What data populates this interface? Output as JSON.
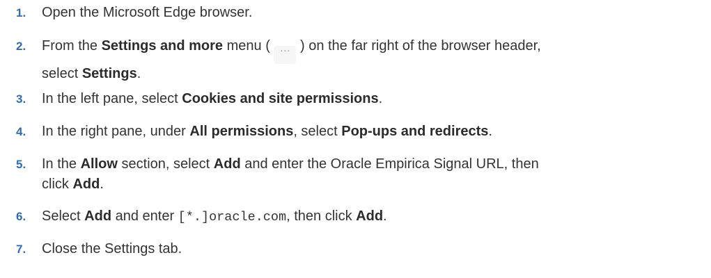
{
  "steps": [
    {
      "num": "1.",
      "parts": [
        "Open the Microsoft Edge browser."
      ]
    },
    {
      "num": "2.",
      "parts": [
        "From the ",
        "Settings and more",
        " menu ( ",
        "···",
        " ) on the far right of the browser header,",
        "select ",
        "Settings",
        "."
      ]
    },
    {
      "num": "3.",
      "parts": [
        "In the left pane, select ",
        "Cookies and site permissions",
        "."
      ]
    },
    {
      "num": "4.",
      "parts": [
        "In the right pane, under ",
        "All permissions",
        ", select ",
        "Pop-ups and redirects",
        "."
      ]
    },
    {
      "num": "5.",
      "parts": [
        "In the ",
        "Allow",
        " section, select ",
        "Add",
        " and enter the Oracle Empirica Signal URL, then",
        "click ",
        "Add",
        "."
      ]
    },
    {
      "num": "6.",
      "parts": [
        "Select ",
        "Add",
        " and enter ",
        "[*.]oracle.com",
        ", then click ",
        "Add",
        "."
      ]
    },
    {
      "num": "7.",
      "parts": [
        "Close the Settings tab."
      ]
    }
  ],
  "colors": {
    "step_number": "#2e6db4",
    "text": "#333333"
  },
  "icons": {
    "settings_and_more": "more-horizontal-icon"
  }
}
